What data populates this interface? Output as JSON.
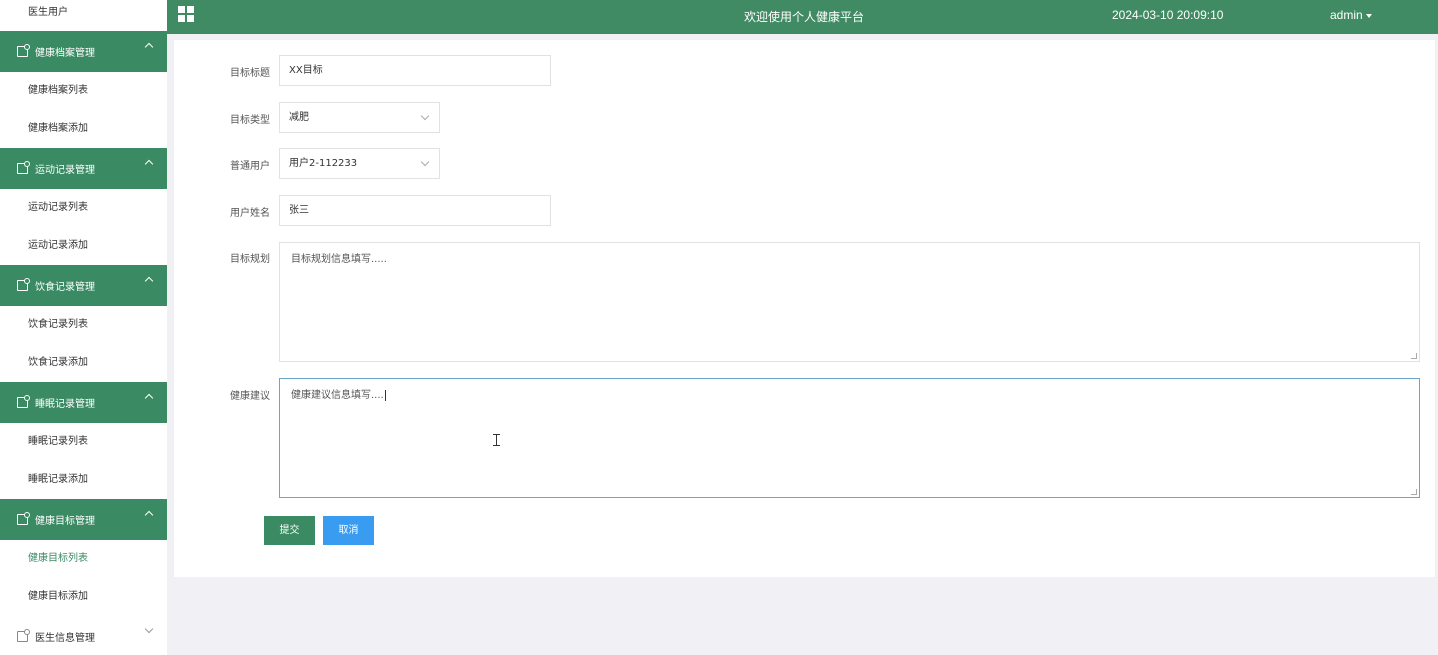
{
  "sidebar": {
    "top_item": "医生用户",
    "groups": [
      {
        "title": "健康档案管理",
        "items": [
          "健康档案列表",
          "健康档案添加"
        ]
      },
      {
        "title": "运动记录管理",
        "items": [
          "运动记录列表",
          "运动记录添加"
        ]
      },
      {
        "title": "饮食记录管理",
        "items": [
          "饮食记录列表",
          "饮食记录添加"
        ]
      },
      {
        "title": "睡眠记录管理",
        "items": [
          "睡眠记录列表",
          "睡眠记录添加"
        ]
      },
      {
        "title": "健康目标管理",
        "items": [
          "健康目标列表",
          "健康目标添加"
        ]
      }
    ],
    "collapsed_group": "医生信息管理"
  },
  "header": {
    "title": "欢迎使用个人健康平台",
    "datetime": "2024-03-10 20:09:10",
    "user": "admin"
  },
  "form": {
    "goal_title": {
      "label": "目标标题",
      "value": "XX目标"
    },
    "goal_type": {
      "label": "目标类型",
      "value": "减肥"
    },
    "normal_user": {
      "label": "普通用户",
      "value": "用户2-112233"
    },
    "user_name": {
      "label": "用户姓名",
      "value": "张三"
    },
    "goal_plan": {
      "label": "目标规划",
      "value": "目标规划信息填写....."
    },
    "health_advice": {
      "label": "健康建议",
      "value": "健康建议信息填写...."
    },
    "submit_label": "提交",
    "cancel_label": "取消"
  },
  "colors": {
    "primary_green": "#3a8a63",
    "header_green": "#418b64",
    "cancel_blue": "#3a9cf0"
  }
}
